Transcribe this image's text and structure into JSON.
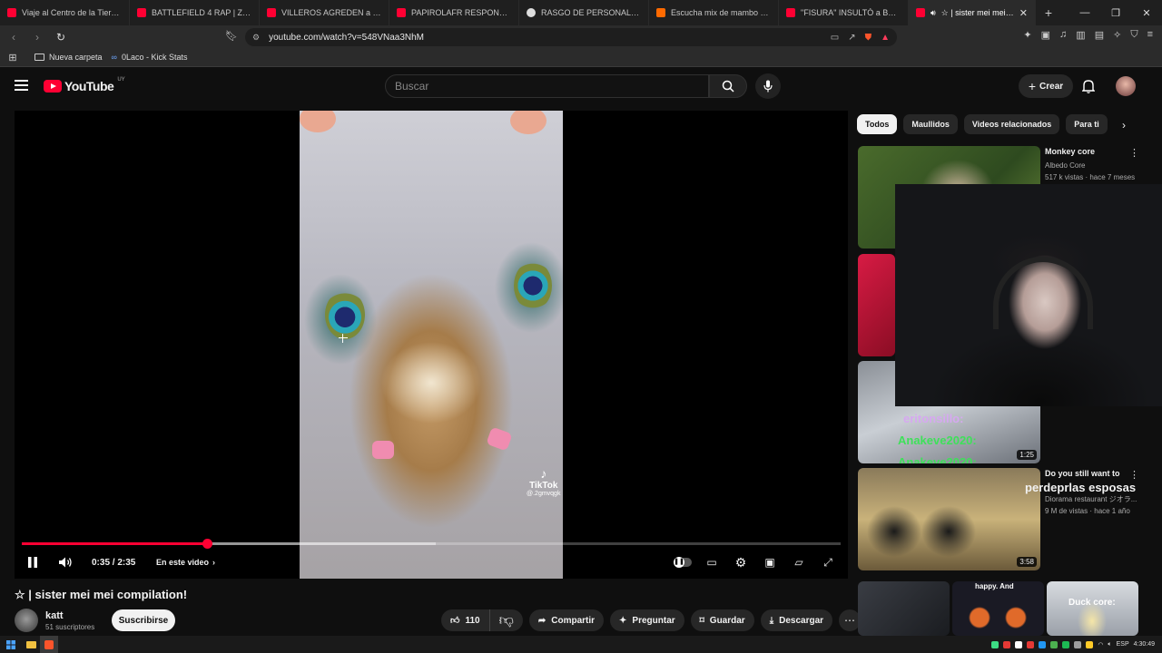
{
  "browser": {
    "tabs": [
      {
        "title": "Viaje al Centro de la Tierra (Tan",
        "icon": "youtube-icon"
      },
      {
        "title": "BATTLEFIELD 4 RAP | Zarcort (C",
        "icon": "youtube-icon"
      },
      {
        "title": "VILLEROS AGREDEN a BRUNEN",
        "icon": "youtube-icon"
      },
      {
        "title": "PAPIROLAFR RESPONDE #1 - Y",
        "icon": "youtube-icon"
      },
      {
        "title": "RASGO DE PERSONALIDAD CU",
        "icon": "google-icon"
      },
      {
        "title": "Escucha mix de mambo pa sali",
        "icon": "soundcloud-icon"
      },
      {
        "title": "\"FISURA\" INSULTÓ a BRUNENG",
        "icon": "youtube-icon"
      }
    ],
    "active_tab": {
      "title": "☆ | sister mei mei comp",
      "icon": "youtube-icon"
    },
    "url": "youtube.com/watch?v=548VNaa3NhM",
    "bookmarks": [
      {
        "label": "Nueva carpeta",
        "icon": "folder-icon"
      },
      {
        "label": "0Laco - Kick Stats",
        "icon": "kick-icon"
      }
    ]
  },
  "youtube": {
    "logo_text": "YouTube",
    "country_code": "UY",
    "search_placeholder": "Buscar",
    "create_label": "Crear"
  },
  "player": {
    "time": "0:35 / 2:35",
    "chapters_label": "En este video",
    "progress_fraction": 0.226,
    "buffered_fraction": 0.505,
    "watermark_brand": "TikTok",
    "watermark_handle": "@.2gmvqgk"
  },
  "video": {
    "title": "☆ | sister mei mei compilation!",
    "channel": "katt",
    "subscribers": "51 suscriptores",
    "subscribe_label": "Suscribirse",
    "likes": "110",
    "share_label": "Compartir",
    "ask_label": "Preguntar",
    "save_label": "Guardar",
    "download_label": "Descargar"
  },
  "sidebar": {
    "chips": [
      "Todos",
      "Maullidos",
      "Videos relacionados",
      "Para ti"
    ],
    "recommendations": [
      {
        "title": "Monkey core",
        "channel": "Albedo Core",
        "meta": "517 k vistas · hace 7 meses",
        "duration": ""
      },
      {
        "title": "",
        "channel": "",
        "meta": "",
        "duration": ""
      },
      {
        "title": "",
        "channel": "",
        "meta": "",
        "duration": "1:25",
        "overlay": [
          "eritonsillo:",
          "Anakeve2020:",
          "Anakeve2020:"
        ]
      },
      {
        "title": "Do you still want to",
        "channel": "Diorama restaurant ジオラ...",
        "meta": "9 M de vistas · hace 1 año",
        "duration": "3:58",
        "overlay_caption": "perdeprlas esposas"
      }
    ],
    "bottom_thumbs": [
      "",
      "happy. And",
      "Duck core:"
    ]
  },
  "taskbar": {
    "language": "ESP",
    "clock": "4:30:49"
  },
  "colors": {
    "youtube_red": "#ff0033",
    "background": "#0f0f0f",
    "chip_bg": "#272727"
  }
}
